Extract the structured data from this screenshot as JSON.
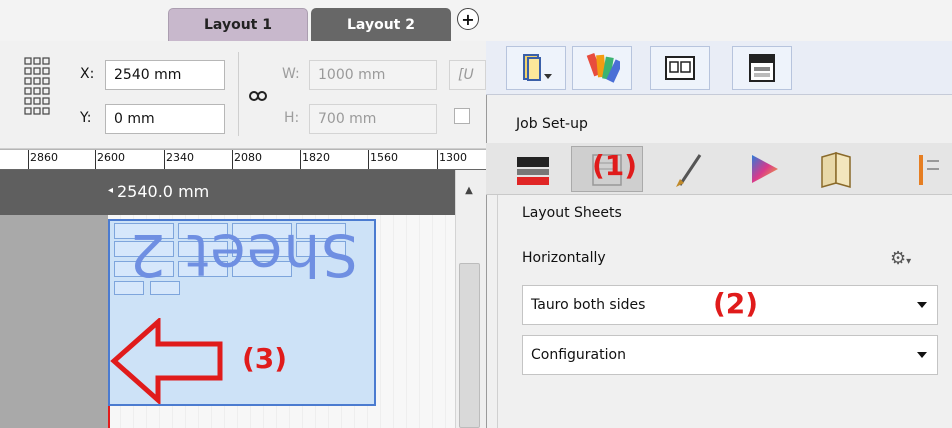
{
  "tabs": [
    {
      "label": "Layout 1"
    },
    {
      "label": "Layout 2"
    }
  ],
  "add_tab": "+",
  "transform": {
    "x_label": "X:",
    "x_value": "2540 mm",
    "y_label": "Y:",
    "y_value": "0 mm",
    "w_label": "W:",
    "w_value": "1000 mm",
    "h_label": "H:",
    "h_value": "700 mm",
    "extra_field": "[U"
  },
  "ruler": {
    "ticks": [
      "2860",
      "2600",
      "2340",
      "2080",
      "1820",
      "1560",
      "1300"
    ]
  },
  "canvas": {
    "position_readout": "2540.0 mm",
    "sheet_label": "Sheet 2"
  },
  "annotations": {
    "one": "(1)",
    "two": "(2)",
    "three": "(3)"
  },
  "panel": {
    "section_title": "Job Set-up",
    "layout_sheets": "Layout Sheets",
    "horizontally": "Horizontally",
    "dropdown1": "Tauro both sides",
    "dropdown2": "Configuration"
  },
  "colors": {
    "accent_red": "#e01b1b",
    "active_tab": "#676767",
    "inactive_tab": "#c8b8cc",
    "sheet_fill": "#cde2f7",
    "sheet_border": "#4b7bd0"
  }
}
